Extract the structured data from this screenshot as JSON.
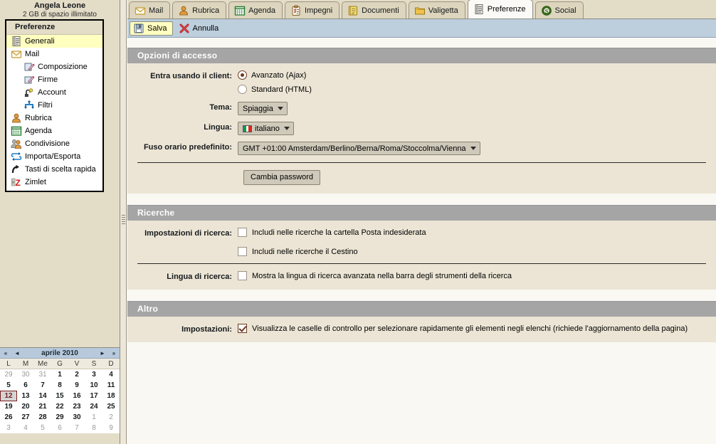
{
  "user": {
    "name": "Angela Leone",
    "quota": "2 GB di spazio illimitato"
  },
  "sidebar": {
    "panel_title": "Preferenze",
    "items": [
      {
        "label": "Generali",
        "icon": "list-document-icon",
        "indent": false,
        "selected": true
      },
      {
        "label": "Mail",
        "icon": "envelope-icon",
        "indent": false,
        "selected": false
      },
      {
        "label": "Composizione",
        "icon": "compose-pencil-icon",
        "indent": true,
        "selected": false
      },
      {
        "label": "Firme",
        "icon": "signature-icon",
        "indent": true,
        "selected": false
      },
      {
        "label": "Account",
        "icon": "account-key-icon",
        "indent": true,
        "selected": false
      },
      {
        "label": "Filtri",
        "icon": "filter-arrows-icon",
        "indent": true,
        "selected": false
      },
      {
        "label": "Rubrica",
        "icon": "person-icon",
        "indent": false,
        "selected": false
      },
      {
        "label": "Agenda",
        "icon": "calendar-icon",
        "indent": false,
        "selected": false
      },
      {
        "label": "Condivisione",
        "icon": "two-people-icon",
        "indent": false,
        "selected": false
      },
      {
        "label": "Importa/Esporta",
        "icon": "import-export-icon",
        "indent": false,
        "selected": false
      },
      {
        "label": "Tasti di scelta rapida",
        "icon": "shortcut-arrow-icon",
        "indent": false,
        "selected": false
      },
      {
        "label": "Zimlet",
        "icon": "zimlet-z-icon",
        "indent": false,
        "selected": false
      }
    ]
  },
  "calendar": {
    "title": "aprile 2010",
    "nav": {
      "prev_year": "«",
      "prev_month": "◄",
      "next_month": "►",
      "next_year": "»"
    },
    "dow": [
      "L",
      "M",
      "Me",
      "G",
      "V",
      "S",
      "D"
    ],
    "weeks": [
      [
        {
          "d": "29",
          "o": true
        },
        {
          "d": "30",
          "o": true
        },
        {
          "d": "31",
          "o": true
        },
        {
          "d": "1",
          "o": false
        },
        {
          "d": "2",
          "o": false
        },
        {
          "d": "3",
          "o": false
        },
        {
          "d": "4",
          "o": false
        }
      ],
      [
        {
          "d": "5",
          "o": false
        },
        {
          "d": "6",
          "o": false
        },
        {
          "d": "7",
          "o": false
        },
        {
          "d": "8",
          "o": false
        },
        {
          "d": "9",
          "o": false
        },
        {
          "d": "10",
          "o": false
        },
        {
          "d": "11",
          "o": false
        }
      ],
      [
        {
          "d": "12",
          "o": false,
          "today": true
        },
        {
          "d": "13",
          "o": false
        },
        {
          "d": "14",
          "o": false
        },
        {
          "d": "15",
          "o": false
        },
        {
          "d": "16",
          "o": false
        },
        {
          "d": "17",
          "o": false
        },
        {
          "d": "18",
          "o": false
        }
      ],
      [
        {
          "d": "19",
          "o": false
        },
        {
          "d": "20",
          "o": false
        },
        {
          "d": "21",
          "o": false
        },
        {
          "d": "22",
          "o": false
        },
        {
          "d": "23",
          "o": false
        },
        {
          "d": "24",
          "o": false
        },
        {
          "d": "25",
          "o": false
        }
      ],
      [
        {
          "d": "26",
          "o": false
        },
        {
          "d": "27",
          "o": false
        },
        {
          "d": "28",
          "o": false
        },
        {
          "d": "29",
          "o": false
        },
        {
          "d": "30",
          "o": false
        },
        {
          "d": "1",
          "o": true
        },
        {
          "d": "2",
          "o": true
        }
      ],
      [
        {
          "d": "3",
          "o": true
        },
        {
          "d": "4",
          "o": true
        },
        {
          "d": "5",
          "o": true
        },
        {
          "d": "6",
          "o": true
        },
        {
          "d": "7",
          "o": true
        },
        {
          "d": "8",
          "o": true
        },
        {
          "d": "9",
          "o": true
        }
      ]
    ]
  },
  "tabs": [
    {
      "label": "Mail",
      "icon": "envelope-icon",
      "active": false
    },
    {
      "label": "Rubrica",
      "icon": "person-icon",
      "active": false
    },
    {
      "label": "Agenda",
      "icon": "calendar-icon",
      "active": false
    },
    {
      "label": "Impegni",
      "icon": "tasks-clipboard-icon",
      "active": false
    },
    {
      "label": "Documenti",
      "icon": "notebook-icon",
      "active": false
    },
    {
      "label": "Valigetta",
      "icon": "folder-icon",
      "active": false
    },
    {
      "label": "Preferenze",
      "icon": "list-document-icon",
      "active": true
    },
    {
      "label": "Social",
      "icon": "social-badge-icon",
      "active": false
    }
  ],
  "toolbar": {
    "save_label": "Salva",
    "cancel_label": "Annulla"
  },
  "sections": {
    "access": {
      "title": "Opzioni di accesso",
      "client_label": "Entra usando il client:",
      "client_options": [
        {
          "label": "Avanzato (Ajax)",
          "selected": true
        },
        {
          "label": "Standard (HTML)",
          "selected": false
        }
      ],
      "theme_label": "Tema:",
      "theme_value": "Spiaggia",
      "language_label": "Lingua:",
      "language_value": "italiano",
      "timezone_label": "Fuso orario predefinito:",
      "timezone_value": "GMT +01:00 Amsterdam/Berlino/Berna/Roma/Stoccolma/Vienna",
      "change_password_label": "Cambia password"
    },
    "search": {
      "title": "Ricerche",
      "settings_label": "Impostazioni di ricerca:",
      "settings_options": [
        {
          "label": "Includi nelle ricerche la cartella Posta indesiderata",
          "checked": false
        },
        {
          "label": "Includi nelle ricerche il Cestino",
          "checked": false
        }
      ],
      "language_label": "Lingua di ricerca:",
      "language_options": [
        {
          "label": "Mostra la lingua di ricerca avanzata nella barra degli strumenti della ricerca",
          "checked": false
        }
      ]
    },
    "other": {
      "title": "Altro",
      "settings_label": "Impostazioni:",
      "settings_options": [
        {
          "label": "Visualizza le caselle di controllo per selezionare rapidamente gli elementi negli elenchi (richiede l'aggiornamento della pagina)",
          "checked": true
        }
      ]
    }
  },
  "colors": {
    "chrome": "#e3dcc7",
    "toolbar": "#bdcedd",
    "section_header": "#a5a5a5",
    "section_body": "#ece5d5",
    "selected_item": "#ffffc0",
    "accent": "#6b3a22"
  }
}
